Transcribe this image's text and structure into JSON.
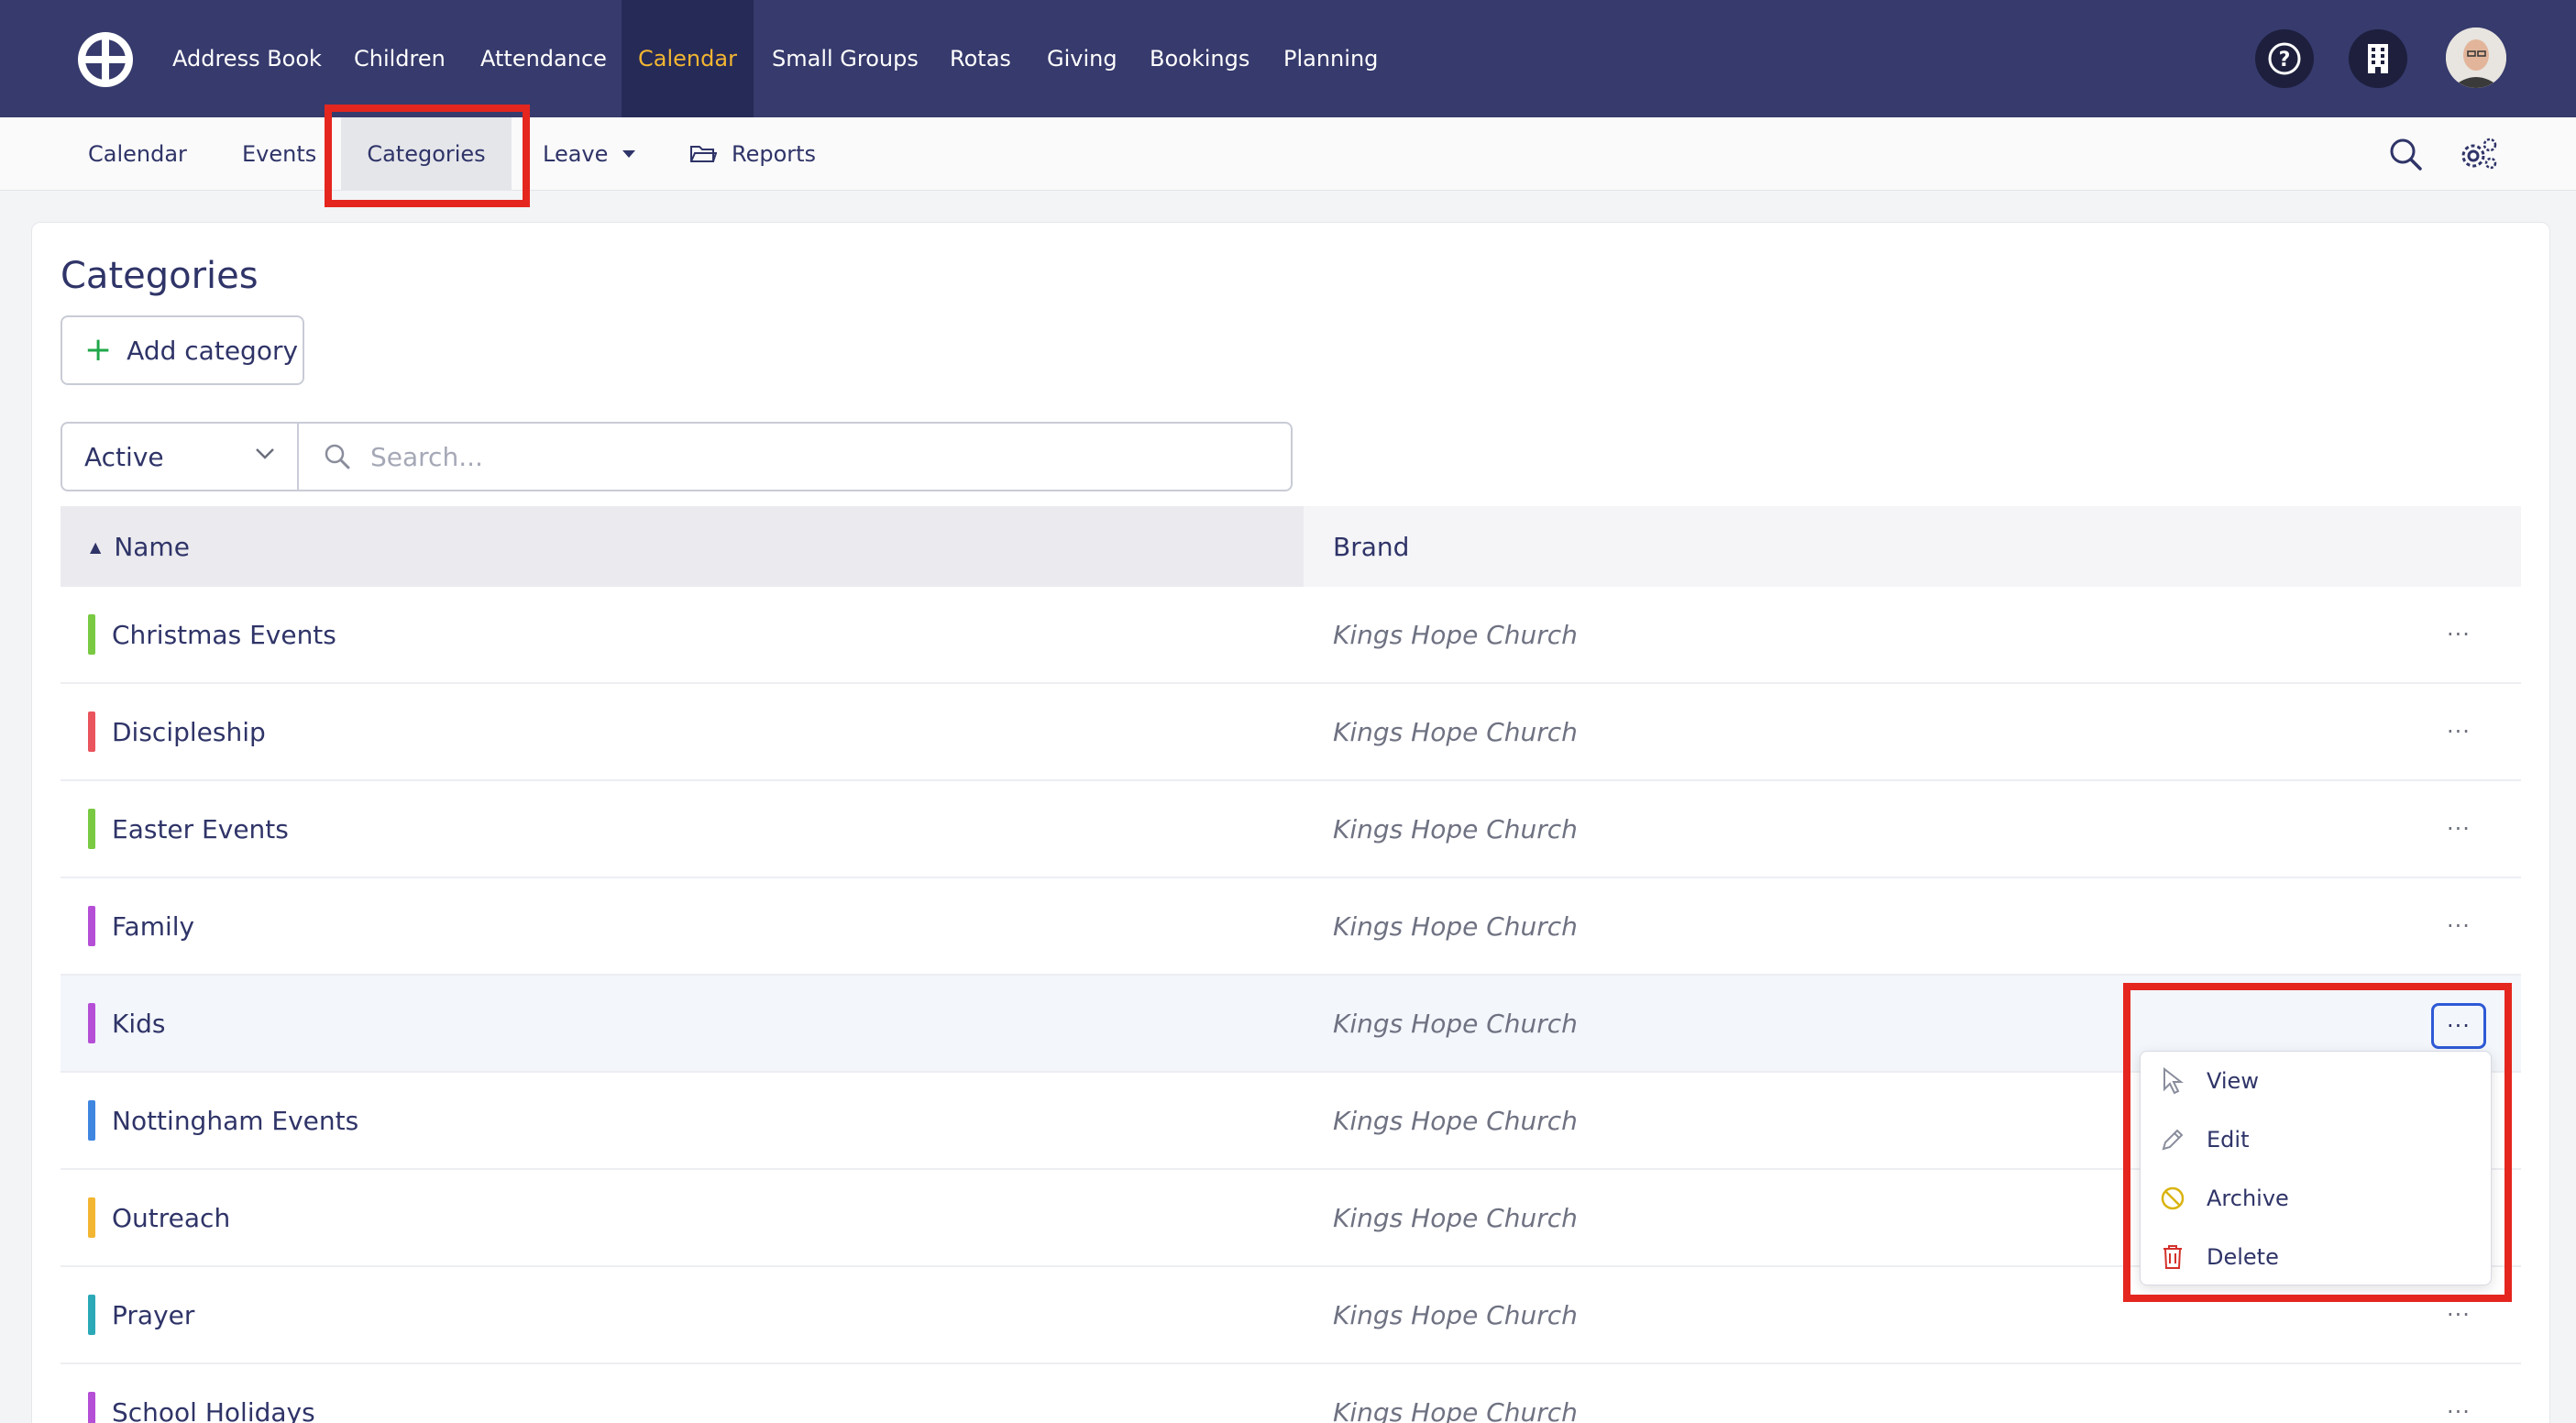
{
  "nav": {
    "items": [
      "Address Book",
      "Children",
      "Attendance",
      "Calendar",
      "Small Groups",
      "Rotas",
      "Giving",
      "Bookings",
      "Planning"
    ],
    "active": "Calendar"
  },
  "subnav": {
    "calendar": "Calendar",
    "events": "Events",
    "categories": "Categories",
    "leave": "Leave",
    "reports": "Reports"
  },
  "page": {
    "title": "Categories",
    "add_button": "Add category"
  },
  "filter": {
    "status_value": "Active",
    "search_placeholder": "Search..."
  },
  "table": {
    "columns": {
      "name": "Name",
      "brand": "Brand"
    },
    "rows": [
      {
        "name": "Christmas Events",
        "brand": "Kings Hope Church",
        "color": "#7ac943"
      },
      {
        "name": "Discipleship",
        "brand": "Kings Hope Church",
        "color": "#e9545d"
      },
      {
        "name": "Easter Events",
        "brand": "Kings Hope Church",
        "color": "#7ac943"
      },
      {
        "name": "Family",
        "brand": "Kings Hope Church",
        "color": "#b54fd6"
      },
      {
        "name": "Kids",
        "brand": "Kings Hope Church",
        "color": "#b54fd6"
      },
      {
        "name": "Nottingham Events",
        "brand": "Kings Hope Church",
        "color": "#3f86e0"
      },
      {
        "name": "Outreach",
        "brand": "Kings Hope Church",
        "color": "#f2b632"
      },
      {
        "name": "Prayer",
        "brand": "Kings Hope Church",
        "color": "#2ba9b7"
      },
      {
        "name": "School Holidays",
        "brand": "Kings Hope Church",
        "color": "#b54fd6"
      }
    ],
    "more_label": "···"
  },
  "menu": {
    "view": "View",
    "edit": "Edit",
    "archive": "Archive",
    "delete": "Delete"
  },
  "colors": {
    "topbar": "#363a6c",
    "active_nav": "#f2b632",
    "highlight": "#e4261f",
    "archive_icon": "#d9b30e",
    "delete_icon": "#d4302b"
  }
}
